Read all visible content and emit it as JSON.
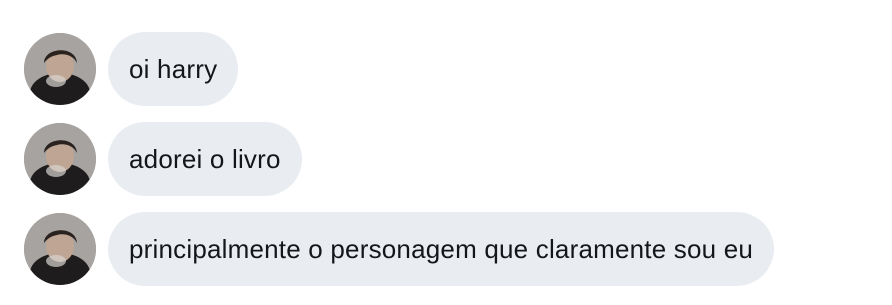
{
  "conversation": {
    "messages": [
      {
        "text": "oi harry",
        "avatar_icon": "user-photo-avatar"
      },
      {
        "text": "adorei o livro",
        "avatar_icon": "user-photo-avatar"
      },
      {
        "text": "principalmente o personagem que claramente sou eu",
        "avatar_icon": "user-photo-avatar"
      }
    ]
  },
  "colors": {
    "bubble": "#e9edf2",
    "text": "#14171a",
    "background": "#ffffff"
  }
}
